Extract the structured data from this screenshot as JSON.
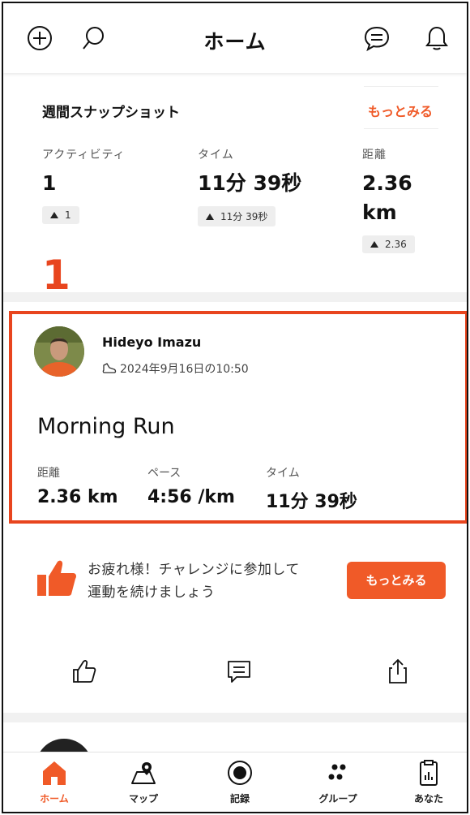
{
  "header": {
    "title": "ホーム",
    "left_icons": [
      "add-circle-icon",
      "search-icon"
    ],
    "right_icons": [
      "chat-icon",
      "bell-icon"
    ]
  },
  "snapshot": {
    "title": "週間スナップショット",
    "more_label": "もっとみる",
    "columns": [
      {
        "label": "アクティビティ",
        "value": "1",
        "change": "1"
      },
      {
        "label": "タイム",
        "value": "11分 39秒",
        "change": "11分 39秒"
      },
      {
        "label": "距離",
        "value": "2.36 km",
        "change": "2.36"
      }
    ]
  },
  "annotation": {
    "number": "1",
    "color": "#e8451e"
  },
  "activity": {
    "user_name": "Hideyo Imazu",
    "date": "2024年9月16日の10:50",
    "title": "Morning Run",
    "stats": [
      {
        "label": "距離",
        "value": "2.36 km"
      },
      {
        "label": "ペース",
        "value": "4:56 /km"
      },
      {
        "label": "タイム",
        "value": "11分 39秒"
      }
    ]
  },
  "challenge": {
    "line1": "お疲れ様！チャレンジに参加して",
    "line2": "運動を続けましょう",
    "button_label": "もっとみる"
  },
  "actions": [
    "thumbs-up-icon",
    "comment-icon",
    "share-icon"
  ],
  "tabs": [
    {
      "label": "ホーム",
      "icon": "home-icon",
      "active": true
    },
    {
      "label": "マップ",
      "icon": "map-icon",
      "active": false
    },
    {
      "label": "記録",
      "icon": "record-icon",
      "active": false
    },
    {
      "label": "グループ",
      "icon": "group-icon",
      "active": false
    },
    {
      "label": "あなた",
      "icon": "profile-stats-icon",
      "active": false
    }
  ],
  "colors": {
    "accent": "#f05a28",
    "annotation": "#e8451e"
  }
}
